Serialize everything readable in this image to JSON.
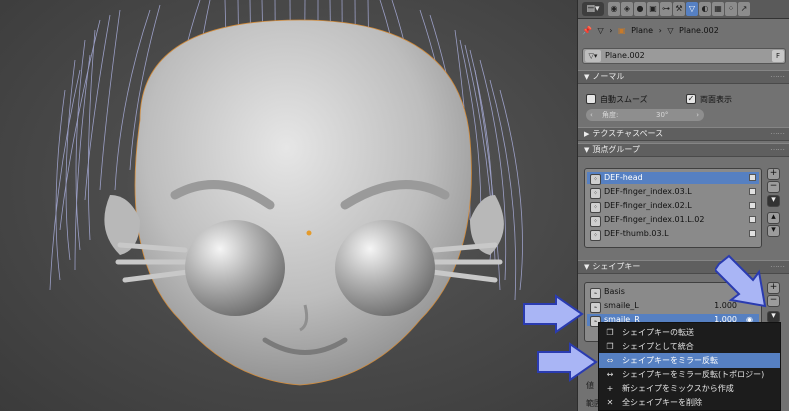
{
  "header": {
    "editor_icon": "properties-editor-icon",
    "tabs": [
      "render-icon",
      "scene-icon",
      "world-icon",
      "object-icon",
      "constraints-icon",
      "modifiers-icon",
      "data-icon",
      "material-icon",
      "texture-icon",
      "particles-icon",
      "physics-icon"
    ],
    "active_tab": "data-icon"
  },
  "breadcrumb": {
    "pin_icon": "pin-icon",
    "items": [
      "Plane",
      "Plane.002"
    ]
  },
  "datablock": {
    "name": "Plane.002",
    "fake_user": "F"
  },
  "normals": {
    "title": "ノーマル",
    "auto_smooth_label": "自動スムーズ",
    "auto_smooth_checked": false,
    "double_sided_label": "両面表示",
    "double_sided_checked": true,
    "angle_label": "角度:",
    "angle_value": "30°"
  },
  "texture_space": {
    "title": "テクスチャスペース"
  },
  "vertex_groups": {
    "title": "頂点グループ",
    "items": [
      {
        "name": "DEF-head",
        "selected": true
      },
      {
        "name": "DEF-finger_index.03.L",
        "selected": false
      },
      {
        "name": "DEF-finger_index.02.L",
        "selected": false
      },
      {
        "name": "DEF-finger_index.01.L.02",
        "selected": false
      },
      {
        "name": "DEF-thumb.03.L",
        "selected": false
      }
    ]
  },
  "shape_keys": {
    "title": "シェイプキー",
    "items": [
      {
        "name": "Basis",
        "value": "",
        "selected": false
      },
      {
        "name": "smaile_L",
        "value": "1.000",
        "selected": false
      },
      {
        "name": "smaile_R",
        "value": "1.000",
        "selected": true
      }
    ]
  },
  "context_menu": {
    "items": [
      {
        "icon": "copy-icon",
        "label": "シェイプキーの転送",
        "highlighted": false
      },
      {
        "icon": "copy-icon",
        "label": "シェイプとして統合",
        "highlighted": false
      },
      {
        "icon": "arrows-horizontal-icon",
        "label": "シェイプキーをミラー反転",
        "highlighted": true
      },
      {
        "icon": "arrows-horizontal-icon",
        "label": "シェイプキーをミラー反転(トポロジー)",
        "highlighted": false
      },
      {
        "icon": "plus-icon",
        "label": "新シェイプをミックスから作成",
        "highlighted": false
      },
      {
        "icon": "x-icon",
        "label": "全シェイプキーを削除",
        "highlighted": false
      }
    ]
  },
  "partial_labels": {
    "bottom_left_1": "値",
    "bottom_left_2": "範囲"
  },
  "colors": {
    "selection": "#5680c2",
    "annotation_arrow": "#a9b5f5",
    "hair": "#b7bcf0"
  }
}
